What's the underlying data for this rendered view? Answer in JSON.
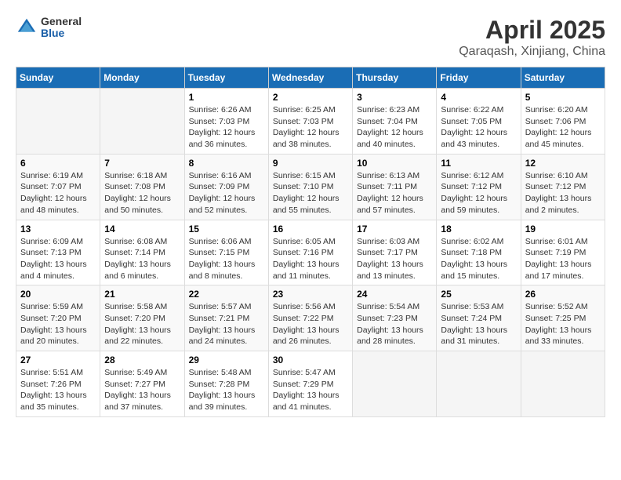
{
  "logo": {
    "general": "General",
    "blue": "Blue"
  },
  "title": "April 2025",
  "subtitle": "Qaraqash, Xinjiang, China",
  "days_header": [
    "Sunday",
    "Monday",
    "Tuesday",
    "Wednesday",
    "Thursday",
    "Friday",
    "Saturday"
  ],
  "weeks": [
    [
      {
        "day": "",
        "detail": ""
      },
      {
        "day": "",
        "detail": ""
      },
      {
        "day": "1",
        "detail": "Sunrise: 6:26 AM\nSunset: 7:03 PM\nDaylight: 12 hours\nand 36 minutes."
      },
      {
        "day": "2",
        "detail": "Sunrise: 6:25 AM\nSunset: 7:03 PM\nDaylight: 12 hours\nand 38 minutes."
      },
      {
        "day": "3",
        "detail": "Sunrise: 6:23 AM\nSunset: 7:04 PM\nDaylight: 12 hours\nand 40 minutes."
      },
      {
        "day": "4",
        "detail": "Sunrise: 6:22 AM\nSunset: 7:05 PM\nDaylight: 12 hours\nand 43 minutes."
      },
      {
        "day": "5",
        "detail": "Sunrise: 6:20 AM\nSunset: 7:06 PM\nDaylight: 12 hours\nand 45 minutes."
      }
    ],
    [
      {
        "day": "6",
        "detail": "Sunrise: 6:19 AM\nSunset: 7:07 PM\nDaylight: 12 hours\nand 48 minutes."
      },
      {
        "day": "7",
        "detail": "Sunrise: 6:18 AM\nSunset: 7:08 PM\nDaylight: 12 hours\nand 50 minutes."
      },
      {
        "day": "8",
        "detail": "Sunrise: 6:16 AM\nSunset: 7:09 PM\nDaylight: 12 hours\nand 52 minutes."
      },
      {
        "day": "9",
        "detail": "Sunrise: 6:15 AM\nSunset: 7:10 PM\nDaylight: 12 hours\nand 55 minutes."
      },
      {
        "day": "10",
        "detail": "Sunrise: 6:13 AM\nSunset: 7:11 PM\nDaylight: 12 hours\nand 57 minutes."
      },
      {
        "day": "11",
        "detail": "Sunrise: 6:12 AM\nSunset: 7:12 PM\nDaylight: 12 hours\nand 59 minutes."
      },
      {
        "day": "12",
        "detail": "Sunrise: 6:10 AM\nSunset: 7:12 PM\nDaylight: 13 hours\nand 2 minutes."
      }
    ],
    [
      {
        "day": "13",
        "detail": "Sunrise: 6:09 AM\nSunset: 7:13 PM\nDaylight: 13 hours\nand 4 minutes."
      },
      {
        "day": "14",
        "detail": "Sunrise: 6:08 AM\nSunset: 7:14 PM\nDaylight: 13 hours\nand 6 minutes."
      },
      {
        "day": "15",
        "detail": "Sunrise: 6:06 AM\nSunset: 7:15 PM\nDaylight: 13 hours\nand 8 minutes."
      },
      {
        "day": "16",
        "detail": "Sunrise: 6:05 AM\nSunset: 7:16 PM\nDaylight: 13 hours\nand 11 minutes."
      },
      {
        "day": "17",
        "detail": "Sunrise: 6:03 AM\nSunset: 7:17 PM\nDaylight: 13 hours\nand 13 minutes."
      },
      {
        "day": "18",
        "detail": "Sunrise: 6:02 AM\nSunset: 7:18 PM\nDaylight: 13 hours\nand 15 minutes."
      },
      {
        "day": "19",
        "detail": "Sunrise: 6:01 AM\nSunset: 7:19 PM\nDaylight: 13 hours\nand 17 minutes."
      }
    ],
    [
      {
        "day": "20",
        "detail": "Sunrise: 5:59 AM\nSunset: 7:20 PM\nDaylight: 13 hours\nand 20 minutes."
      },
      {
        "day": "21",
        "detail": "Sunrise: 5:58 AM\nSunset: 7:20 PM\nDaylight: 13 hours\nand 22 minutes."
      },
      {
        "day": "22",
        "detail": "Sunrise: 5:57 AM\nSunset: 7:21 PM\nDaylight: 13 hours\nand 24 minutes."
      },
      {
        "day": "23",
        "detail": "Sunrise: 5:56 AM\nSunset: 7:22 PM\nDaylight: 13 hours\nand 26 minutes."
      },
      {
        "day": "24",
        "detail": "Sunrise: 5:54 AM\nSunset: 7:23 PM\nDaylight: 13 hours\nand 28 minutes."
      },
      {
        "day": "25",
        "detail": "Sunrise: 5:53 AM\nSunset: 7:24 PM\nDaylight: 13 hours\nand 31 minutes."
      },
      {
        "day": "26",
        "detail": "Sunrise: 5:52 AM\nSunset: 7:25 PM\nDaylight: 13 hours\nand 33 minutes."
      }
    ],
    [
      {
        "day": "27",
        "detail": "Sunrise: 5:51 AM\nSunset: 7:26 PM\nDaylight: 13 hours\nand 35 minutes."
      },
      {
        "day": "28",
        "detail": "Sunrise: 5:49 AM\nSunset: 7:27 PM\nDaylight: 13 hours\nand 37 minutes."
      },
      {
        "day": "29",
        "detail": "Sunrise: 5:48 AM\nSunset: 7:28 PM\nDaylight: 13 hours\nand 39 minutes."
      },
      {
        "day": "30",
        "detail": "Sunrise: 5:47 AM\nSunset: 7:29 PM\nDaylight: 13 hours\nand 41 minutes."
      },
      {
        "day": "",
        "detail": ""
      },
      {
        "day": "",
        "detail": ""
      },
      {
        "day": "",
        "detail": ""
      }
    ]
  ]
}
